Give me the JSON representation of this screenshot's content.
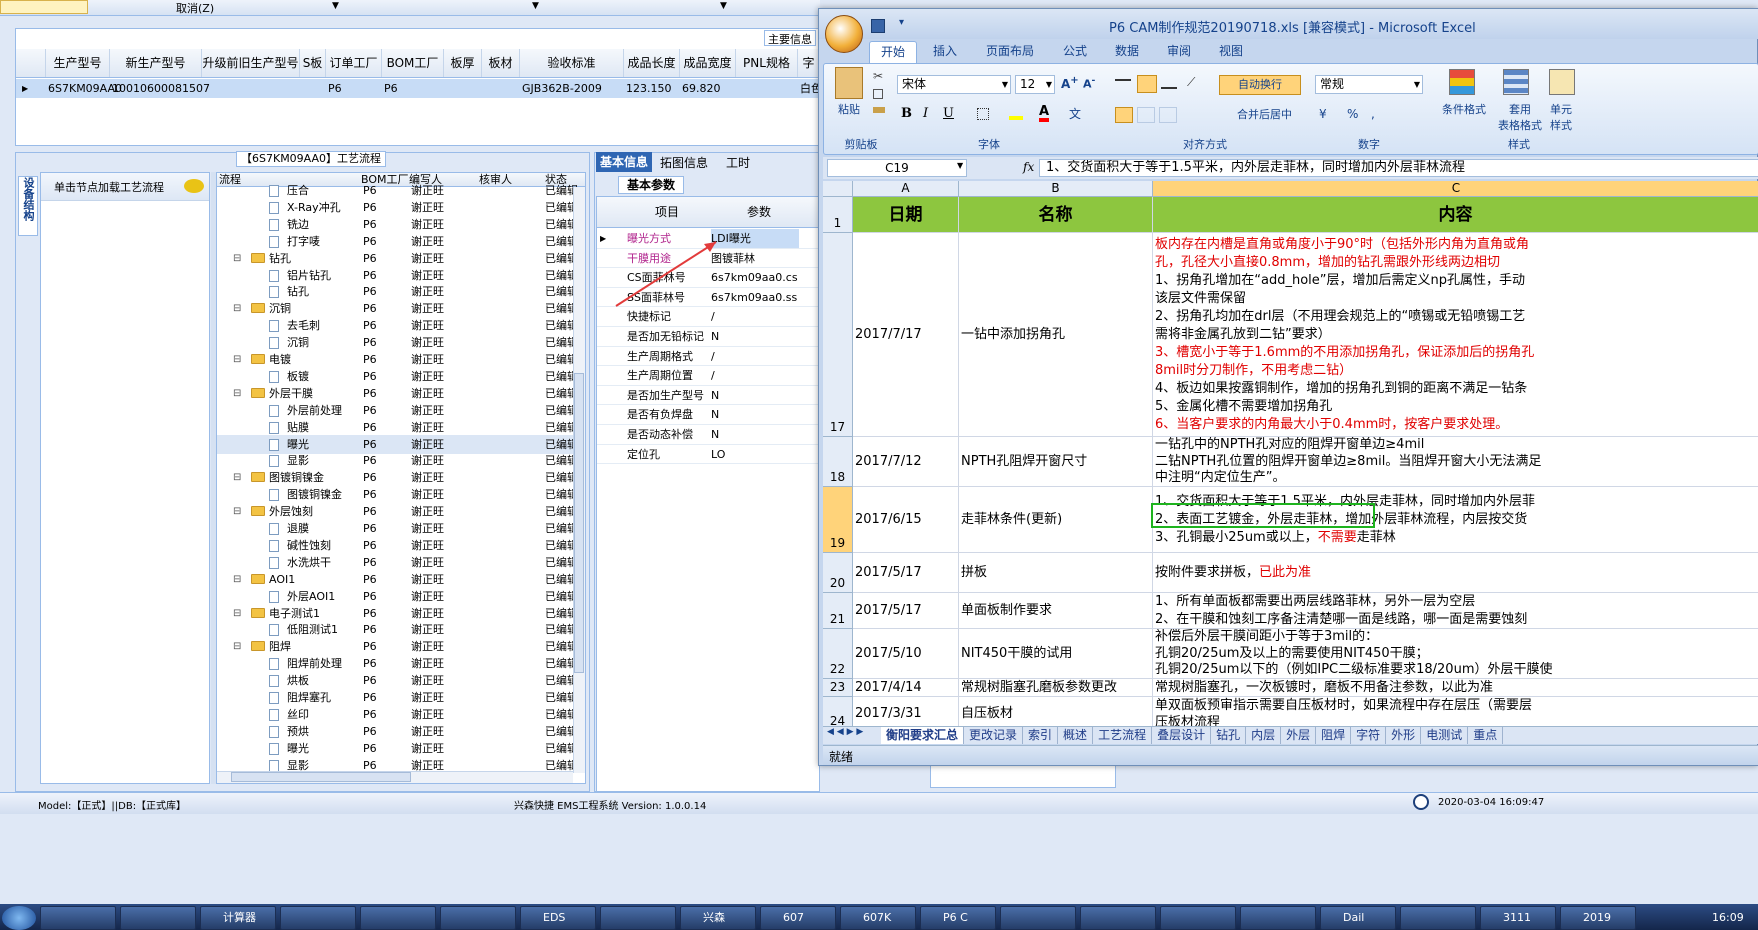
{
  "top": {
    "cancel_label": "取消(Z)",
    "main_info_tab": "主要信息"
  },
  "order_table": {
    "headers": [
      "生产型号",
      "新生产型号",
      "升级前旧生产型号",
      "S板",
      "订单工厂",
      "BOM工厂",
      "板厚",
      "板材",
      "验收标准",
      "成品长度",
      "成品宽度",
      "PNL规格",
      "字"
    ],
    "row": [
      "6S7KM09AA0",
      "10010600081507",
      "",
      "",
      "P6",
      "P6",
      "",
      "",
      "GJB362B-2009",
      "123.150",
      "69.820",
      "",
      "白色"
    ]
  },
  "process_panel": {
    "title": "【6S7KM09AA0】工艺流程",
    "side_tab": "设备结构",
    "load_hint": "单击节点加载工艺流程",
    "headers": [
      "流程",
      "BOM工厂",
      "编写人",
      "核审人",
      "状态"
    ],
    "rows": [
      {
        "level": 2,
        "type": "doc",
        "name": "压合",
        "bom": "P6",
        "writer": "谢正旺",
        "status": "已编辑"
      },
      {
        "level": 2,
        "type": "doc",
        "name": "X-Ray冲孔",
        "bom": "P6",
        "writer": "谢正旺",
        "status": "已编辑"
      },
      {
        "level": 2,
        "type": "doc",
        "name": "铣边",
        "bom": "P6",
        "writer": "谢正旺",
        "status": "已编辑"
      },
      {
        "level": 2,
        "type": "doc",
        "name": "打字唛",
        "bom": "P6",
        "writer": "谢正旺",
        "status": "已编辑"
      },
      {
        "level": 1,
        "type": "folder",
        "name": "钻孔",
        "bom": "P6",
        "writer": "谢正旺",
        "status": "已编辑"
      },
      {
        "level": 2,
        "type": "doc",
        "name": "铝片钻孔",
        "bom": "P6",
        "writer": "谢正旺",
        "status": "已编辑"
      },
      {
        "level": 2,
        "type": "doc",
        "name": "钻孔",
        "bom": "P6",
        "writer": "谢正旺",
        "status": "已编辑"
      },
      {
        "level": 1,
        "type": "folder",
        "name": "沉铜",
        "bom": "P6",
        "writer": "谢正旺",
        "status": "已编辑"
      },
      {
        "level": 2,
        "type": "doc",
        "name": "去毛刺",
        "bom": "P6",
        "writer": "谢正旺",
        "status": "已编辑"
      },
      {
        "level": 2,
        "type": "doc",
        "name": "沉铜",
        "bom": "P6",
        "writer": "谢正旺",
        "status": "已编辑"
      },
      {
        "level": 1,
        "type": "folder",
        "name": "电镀",
        "bom": "P6",
        "writer": "谢正旺",
        "status": "已编辑"
      },
      {
        "level": 2,
        "type": "doc",
        "name": "板镀",
        "bom": "P6",
        "writer": "谢正旺",
        "status": "已编辑"
      },
      {
        "level": 1,
        "type": "folder",
        "name": "外层干膜",
        "bom": "P6",
        "writer": "谢正旺",
        "status": "已编辑"
      },
      {
        "level": 2,
        "type": "doc",
        "name": "外层前处理",
        "bom": "P6",
        "writer": "谢正旺",
        "status": "已编辑"
      },
      {
        "level": 2,
        "type": "doc",
        "name": "贴膜",
        "bom": "P6",
        "writer": "谢正旺",
        "status": "已编辑"
      },
      {
        "level": 2,
        "type": "doc",
        "name": "曝光",
        "bom": "P6",
        "writer": "谢正旺",
        "status": "已编辑",
        "selected": true
      },
      {
        "level": 2,
        "type": "doc",
        "name": "显影",
        "bom": "P6",
        "writer": "谢正旺",
        "status": "已编辑"
      },
      {
        "level": 1,
        "type": "folder",
        "name": "图镀铜镍金",
        "bom": "P6",
        "writer": "谢正旺",
        "status": "已编辑"
      },
      {
        "level": 2,
        "type": "doc",
        "name": "图镀铜镍金",
        "bom": "P6",
        "writer": "谢正旺",
        "status": "已编辑"
      },
      {
        "level": 1,
        "type": "folder",
        "name": "外层蚀刻",
        "bom": "P6",
        "writer": "谢正旺",
        "status": "已编辑"
      },
      {
        "level": 2,
        "type": "doc",
        "name": "退膜",
        "bom": "P6",
        "writer": "谢正旺",
        "status": "已编辑"
      },
      {
        "level": 2,
        "type": "doc",
        "name": "碱性蚀刻",
        "bom": "P6",
        "writer": "谢正旺",
        "status": "已编辑"
      },
      {
        "level": 2,
        "type": "doc",
        "name": "水洗烘干",
        "bom": "P6",
        "writer": "谢正旺",
        "status": "已编辑"
      },
      {
        "level": 1,
        "type": "folder",
        "name": "AOI1",
        "bom": "P6",
        "writer": "谢正旺",
        "status": "已编辑"
      },
      {
        "level": 2,
        "type": "doc",
        "name": "外层AOI1",
        "bom": "P6",
        "writer": "谢正旺",
        "status": "已编辑"
      },
      {
        "level": 1,
        "type": "folder",
        "name": "电子测试1",
        "bom": "P6",
        "writer": "谢正旺",
        "status": "已编辑"
      },
      {
        "level": 2,
        "type": "doc",
        "name": "低阻测试1",
        "bom": "P6",
        "writer": "谢正旺",
        "status": "已编辑"
      },
      {
        "level": 1,
        "type": "folder",
        "name": "阻焊",
        "bom": "P6",
        "writer": "谢正旺",
        "status": "已编辑"
      },
      {
        "level": 2,
        "type": "doc",
        "name": "阻焊前处理",
        "bom": "P6",
        "writer": "谢正旺",
        "status": "已编辑"
      },
      {
        "level": 2,
        "type": "doc",
        "name": "烘板",
        "bom": "P6",
        "writer": "谢正旺",
        "status": "已编辑"
      },
      {
        "level": 2,
        "type": "doc",
        "name": "阻焊塞孔",
        "bom": "P6",
        "writer": "谢正旺",
        "status": "已编辑"
      },
      {
        "level": 2,
        "type": "doc",
        "name": "丝印",
        "bom": "P6",
        "writer": "谢正旺",
        "status": "已编辑"
      },
      {
        "level": 2,
        "type": "doc",
        "name": "预烘",
        "bom": "P6",
        "writer": "谢正旺",
        "status": "已编辑"
      },
      {
        "level": 2,
        "type": "doc",
        "name": "曝光",
        "bom": "P6",
        "writer": "谢正旺",
        "status": "已编辑"
      },
      {
        "level": 2,
        "type": "doc",
        "name": "显影",
        "bom": "P6",
        "writer": "谢正旺",
        "status": "已编辑"
      }
    ]
  },
  "info_panel": {
    "tabs": [
      "基本信息",
      "拓图信息",
      "工时"
    ],
    "subtab": "基本参数",
    "headers": [
      "项目",
      "参数"
    ],
    "rows": [
      {
        "item": "曝光方式",
        "value": "LDI曝光",
        "highlight": true
      },
      {
        "item": "干膜用途",
        "value": "图镀菲林",
        "highlight": true
      },
      {
        "item": "CS面菲林号",
        "value": "6s7km09aa0.cs"
      },
      {
        "item": "SS面菲林号",
        "value": "6s7km09aa0.ss"
      },
      {
        "item": "快捷标记",
        "value": "/"
      },
      {
        "item": "是否加无铅标记",
        "value": "N"
      },
      {
        "item": "生产周期格式",
        "value": "/"
      },
      {
        "item": "生产周期位置",
        "value": "/"
      },
      {
        "item": "是否加生产型号",
        "value": "N"
      },
      {
        "item": "是否有负焊盘",
        "value": "N"
      },
      {
        "item": "是否动态补偿",
        "value": "N"
      },
      {
        "item": "定位孔",
        "value": "LO"
      }
    ]
  },
  "status_bar": {
    "model": "Model:【正式】||DB:【正式库】",
    "system": "兴森快捷 EMS工程系统 Version: 1.0.0.14",
    "datetime": "2020-03-04 16:09:47"
  },
  "excel": {
    "title": "P6 CAM制作规范20190718.xls  [兼容模式] - Microsoft Excel",
    "ribbon_tabs": [
      "开始",
      "插入",
      "页面布局",
      "公式",
      "数据",
      "审阅",
      "视图"
    ],
    "font_name": "宋体",
    "font_size": "12",
    "wrap_text": "自动换行",
    "merge_center": "合并后居中",
    "number_format": "常规",
    "paste_label": "粘贴",
    "cond_format": "条件格式",
    "table_format": "套用\n表格格式",
    "cell_style": "单元\n样式",
    "groups": [
      "剪贴板",
      "字体",
      "对齐方式",
      "数字",
      "样式"
    ],
    "name_box": "C19",
    "fx": "fx",
    "formula": "1、交货面积大于等于1.5平米，内外层走菲林，同时增加内外层菲林流程",
    "columns": [
      "A",
      "B",
      "C"
    ],
    "header_row": {
      "num": "1",
      "a": "日期",
      "b": "名称",
      "c": "内容"
    },
    "rows": [
      {
        "num": "17",
        "date": "2017/7/17",
        "name": "一钻中添加拐角孔",
        "lines": [
          {
            "t": "板内存在内槽是直角或角度小于90°时（包括外形内角为直角或角",
            "red": true
          },
          {
            "t": "孔，孔径大小直接0.8mm，增加的钻孔需跟外形线两边相切",
            "red": true
          },
          {
            "t": "1、拐角孔增加在“add_hole”层，增加后需定义np孔属性，手动"
          },
          {
            "t": "该层文件需保留"
          },
          {
            "t": "2、拐角孔均加在drl层（不用理会规范上的“喷锡或无铅喷锡工艺"
          },
          {
            "t": "需将非金属孔放到二钻”要求）"
          },
          {
            "t": "3、槽宽小于等于1.6mm的不用添加拐角孔，保证添加后的拐角孔",
            "red": true
          },
          {
            "t": "8mil时分刀制作，不用考虑二钻）",
            "red": true
          },
          {
            "t": "4、板边如果按露铜制作，增加的拐角孔到铜的距离不满足一钻条"
          },
          {
            "t": "5、金属化槽不需要增加拐角孔"
          },
          {
            "t": "6、当客户要求的内角最大小于0.4mm时，按客户要求处理。",
            "red": true
          }
        ]
      },
      {
        "num": "18",
        "date": "2017/7/12",
        "name": "NPTH孔阻焊开窗尺寸",
        "lines": [
          {
            "t": "一钻孔中的NPTH孔对应的阻焊开窗单边≥4mil"
          },
          {
            "t": "二钻NPTH孔位置的阻焊开窗单边≥8mil。当阻焊开窗大小无法满足"
          },
          {
            "t": "中注明“内定位生产”。"
          }
        ]
      },
      {
        "num": "19",
        "date": "2017/6/15",
        "name": "走菲林条件(更新)",
        "lines": [
          {
            "t": "1、交货面积大于等于1.5平米，内外层走菲林，同时增加内外层菲"
          },
          {
            "t": "2、表面工艺镀金，外层走菲林，增加外层菲林流程，内层按交货"
          },
          {
            "t": "3、孔铜最小25um或以上，",
            "tail": "不需要",
            "tail2": "走菲林"
          }
        ]
      },
      {
        "num": "20",
        "date": "2017/5/17",
        "name": "拼板",
        "lines": [
          {
            "t": "按附件要求拼板，",
            "tail": "已此为准"
          }
        ]
      },
      {
        "num": "21",
        "date": "2017/5/17",
        "name": "单面板制作要求",
        "lines": [
          {
            "t": "1、所有单面板都需要出两层线路菲林，另外一层为空层"
          },
          {
            "t": "2、在干膜和蚀刻工序备注清楚哪一面是线路，哪一面是需要蚀刻"
          }
        ]
      },
      {
        "num": "22",
        "date": "2017/5/10",
        "name": "NIT450干膜的试用",
        "lines": [
          {
            "t": "补偿后外层干膜间距小于等于3mil的："
          },
          {
            "t": "孔铜20/25um及以上的需要使用NIT450干膜；"
          },
          {
            "t": "孔铜20/25um以下的（例如IPC二级标准要求18/20um）外层干膜使"
          }
        ]
      },
      {
        "num": "23",
        "date": "2017/4/14",
        "name": "常规树脂塞孔磨板参数更改",
        "lines": [
          {
            "t": "常规树脂塞孔，一次板镀时，磨板不用备注参数，以此为准"
          }
        ]
      },
      {
        "num": "24",
        "date": "2017/3/31",
        "name": "自压板材",
        "lines": [
          {
            "t": "单双面板预审指示需要自压板材时，如果流程中存在层压（需要层"
          },
          {
            "t": "压板材流程"
          }
        ]
      }
    ],
    "sheet_tabs": [
      "衡阳要求汇总",
      "更改记录",
      "索引",
      "概述",
      "工艺流程",
      "叠层设计",
      "钻孔",
      "内层",
      "外层",
      "阻焊",
      "字符",
      "外形",
      "电测试",
      "重点"
    ],
    "ready": "就绪"
  },
  "taskbar": {
    "items": [
      "",
      "",
      "计算器",
      "",
      "",
      "",
      "EDS",
      "",
      "兴森",
      "607",
      "607K",
      "P6 C",
      "",
      "",
      "",
      "",
      "Dail",
      "",
      "3111",
      "2019"
    ],
    "time": "16:09"
  }
}
